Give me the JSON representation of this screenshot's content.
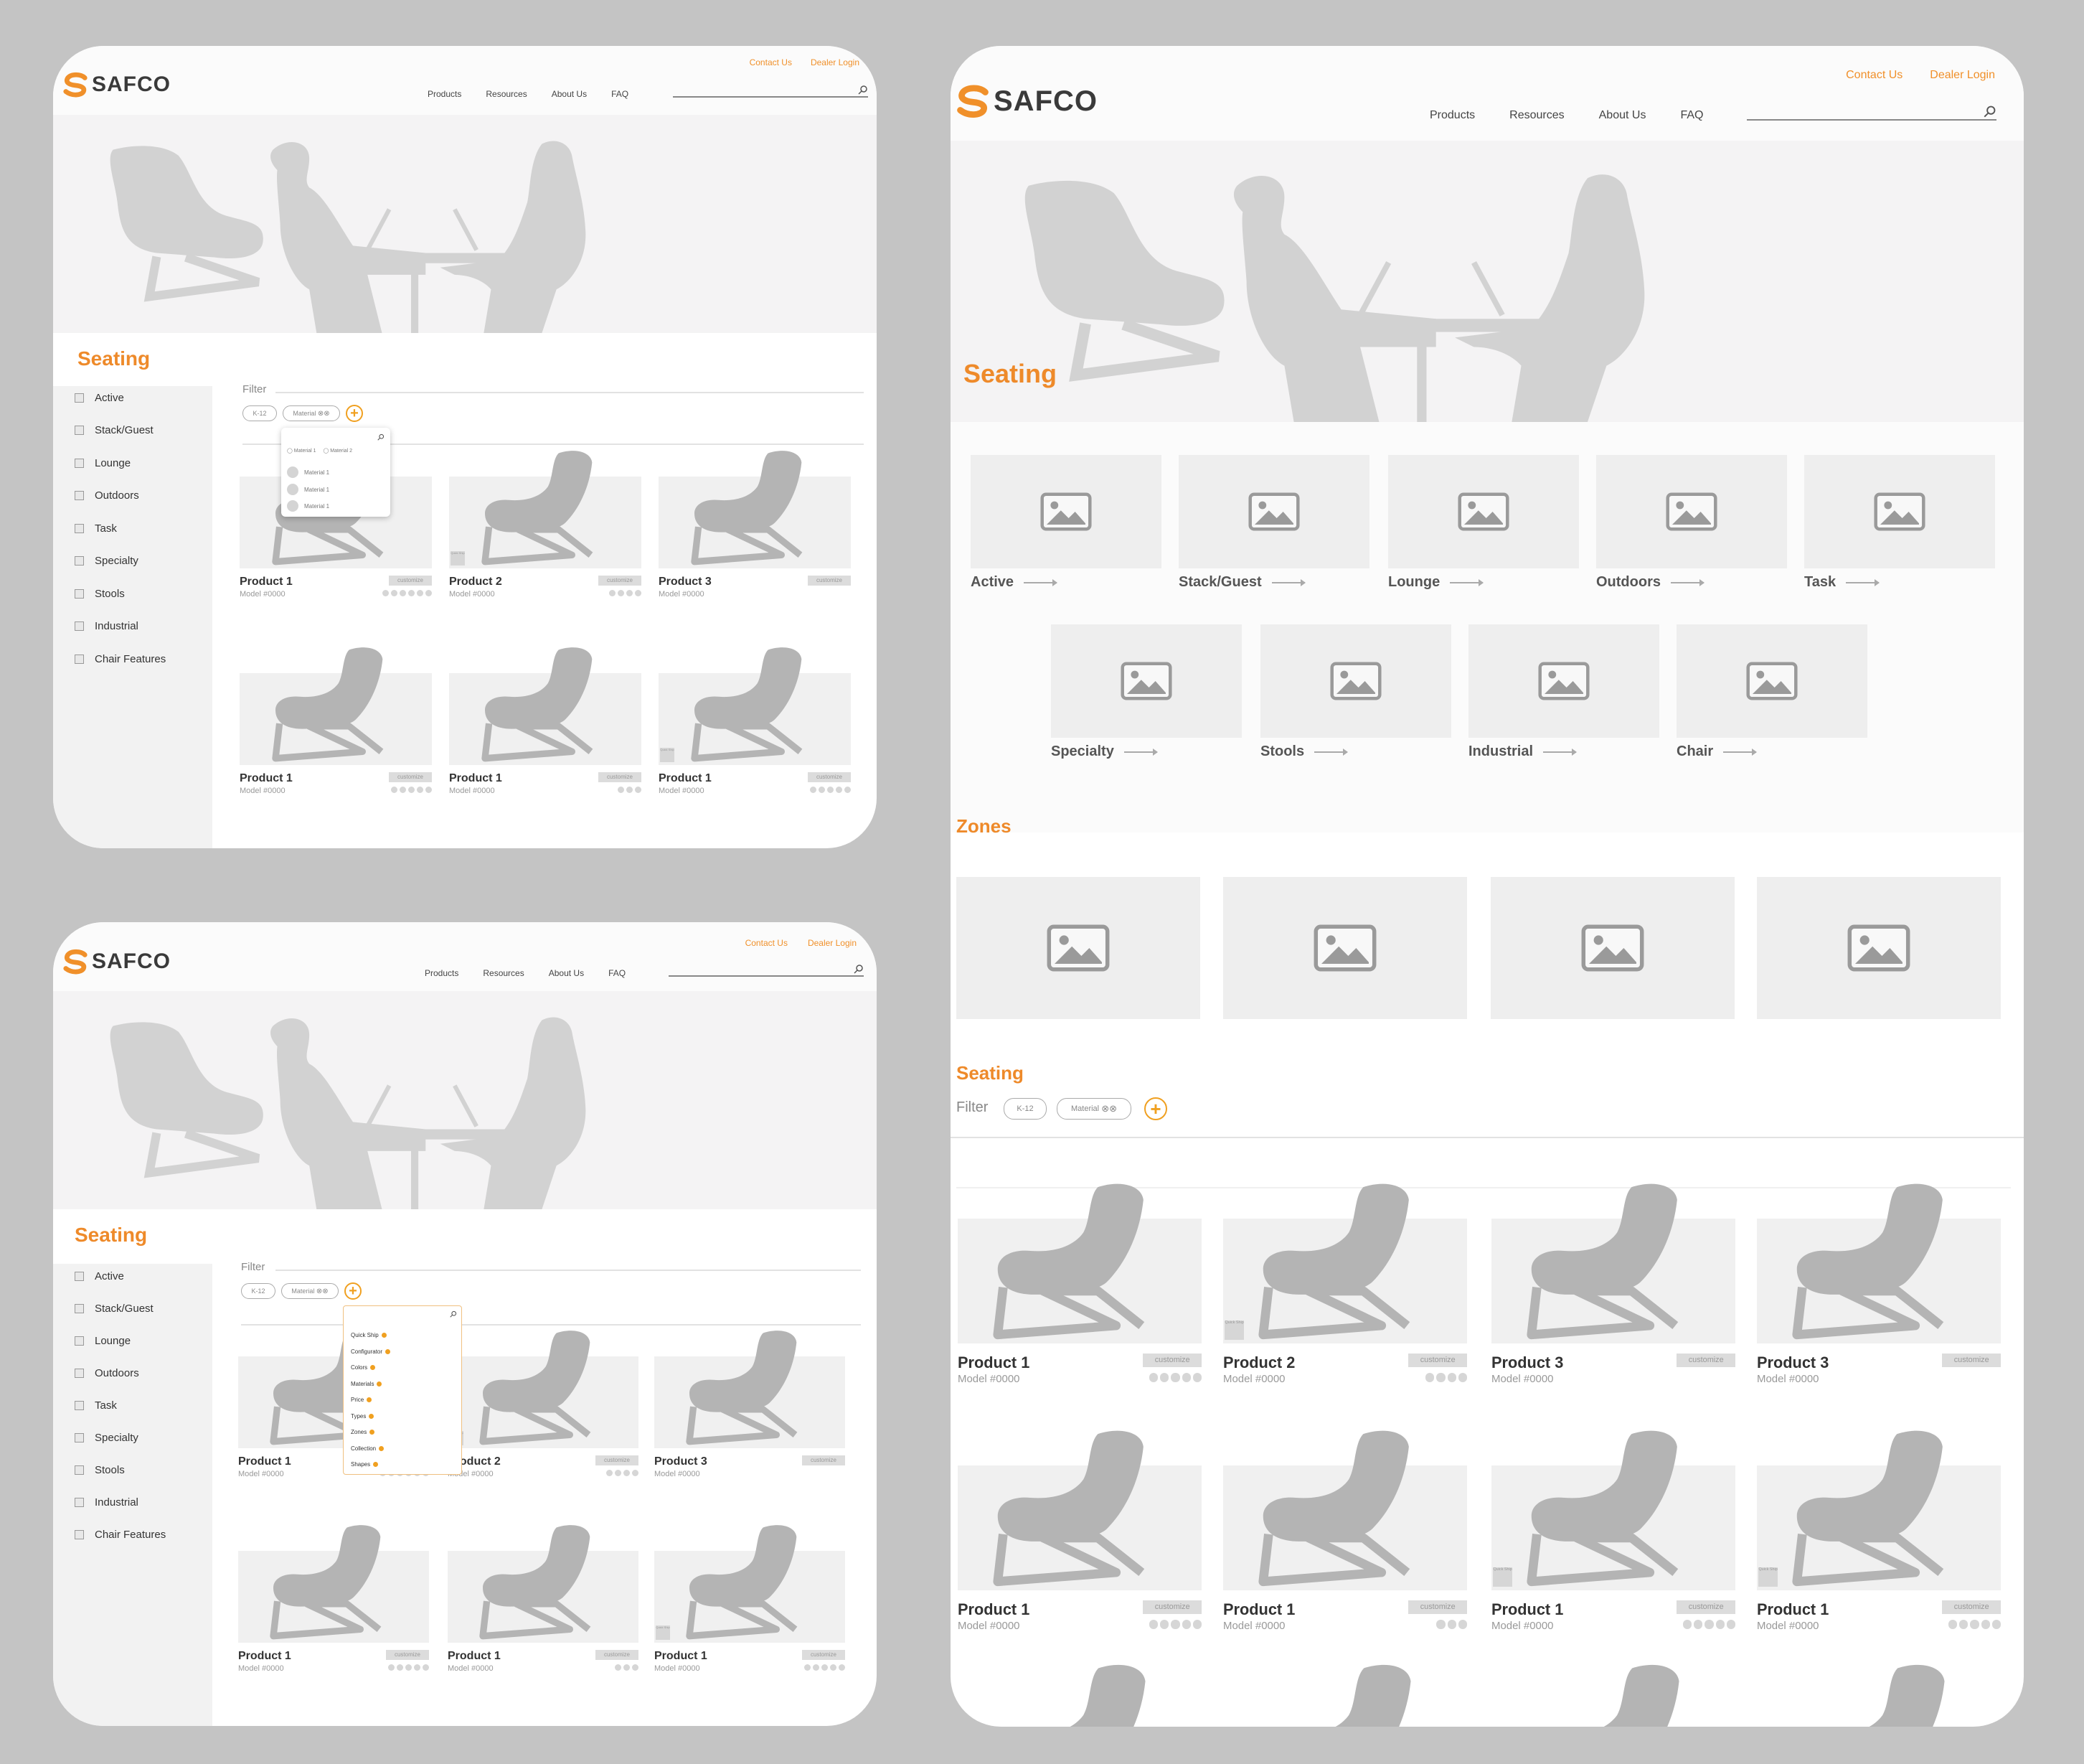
{
  "brand": {
    "name": "SAFCO",
    "accent": "#ee8a2a",
    "logo_color": "#f0902a"
  },
  "header": {
    "utility": [
      "Contact Us",
      "Dealer Login"
    ],
    "nav": [
      "Products",
      "Resources",
      "About Us",
      "FAQ"
    ]
  },
  "page_title": "Seating",
  "sidebar": {
    "items": [
      "Active",
      "Stack/Guest",
      "Lounge",
      "Outdoors",
      "Task",
      "Specialty",
      "Stools",
      "Industrial",
      "Chair Features"
    ]
  },
  "filter": {
    "label": "Filter",
    "pills": [
      "K-12",
      "Material"
    ],
    "add_icon": "plus-icon"
  },
  "material_dropdown": {
    "tabs": [
      "Material 1",
      "Material 2"
    ],
    "options": [
      "Material 1",
      "Material 1",
      "Material 1"
    ]
  },
  "filter_dropdown": {
    "options": [
      "Quick Ship",
      "Configurator",
      "Colors",
      "Materials",
      "Price",
      "Types",
      "Zones",
      "Collection",
      "Shapes"
    ]
  },
  "products_v1": [
    {
      "name": "Product 1",
      "model": "Model #0000",
      "cta": "customize",
      "dots": 6,
      "badge": ""
    },
    {
      "name": "Product 2",
      "model": "Model #0000",
      "cta": "customize",
      "dots": 4,
      "badge": "Quick Ship"
    },
    {
      "name": "Product 3",
      "model": "Model #0000",
      "cta": "customize",
      "dots": 0,
      "badge": ""
    },
    {
      "name": "Product 1",
      "model": "Model #0000",
      "cta": "customize",
      "dots": 5,
      "badge": ""
    },
    {
      "name": "Product 1",
      "model": "Model #0000",
      "cta": "customize",
      "dots": 3,
      "badge": ""
    },
    {
      "name": "Product 1",
      "model": "Model #0000",
      "cta": "customize",
      "dots": 5,
      "badge": "Quick Ship"
    }
  ],
  "categories": [
    {
      "label": "Active"
    },
    {
      "label": "Stack/Guest"
    },
    {
      "label": "Lounge"
    },
    {
      "label": "Outdoors"
    },
    {
      "label": "Task"
    },
    {
      "label": "Specialty"
    },
    {
      "label": "Stools"
    },
    {
      "label": "Industrial"
    },
    {
      "label": "Chair"
    }
  ],
  "zones_title": "Zones",
  "seating_section_title": "Seating",
  "products_v3": [
    {
      "name": "Product 1",
      "model": "Model #0000",
      "cta": "customize",
      "dots": 5,
      "badge": ""
    },
    {
      "name": "Product 2",
      "model": "Model #0000",
      "cta": "customize",
      "dots": 4,
      "badge": "Quick Ship"
    },
    {
      "name": "Product 3",
      "model": "Model #0000",
      "cta": "customize",
      "dots": 0,
      "badge": ""
    },
    {
      "name": "Product 3",
      "model": "Model #0000",
      "cta": "customize",
      "dots": 0,
      "badge": ""
    },
    {
      "name": "Product 1",
      "model": "Model #0000",
      "cta": "customize",
      "dots": 5,
      "badge": ""
    },
    {
      "name": "Product 1",
      "model": "Model #0000",
      "cta": "customize",
      "dots": 3,
      "badge": ""
    },
    {
      "name": "Product 1",
      "model": "Model #0000",
      "cta": "customize",
      "dots": 5,
      "badge": "Quick Ship"
    },
    {
      "name": "Product 1",
      "model": "Model #0000",
      "cta": "customize",
      "dots": 5,
      "badge": "Quick Ship"
    }
  ]
}
